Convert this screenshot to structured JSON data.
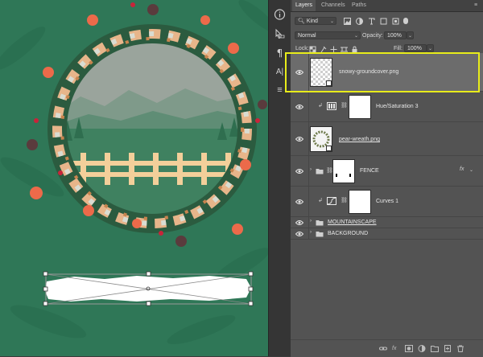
{
  "panel": {
    "tabs": [
      {
        "label": "Layers",
        "active": true
      },
      {
        "label": "Channels",
        "active": false
      },
      {
        "label": "Paths",
        "active": false
      }
    ],
    "filter": {
      "kind_label": "Kind"
    },
    "blend": {
      "mode": "Normal",
      "opacity_label": "Opacity:",
      "opacity_value": "100%"
    },
    "lock": {
      "label": "Lock:",
      "fill_label": "Fill:",
      "fill_value": "100%"
    },
    "layers": [
      {
        "name": "snowy-groundcover.png",
        "type": "smart-object",
        "selected": true,
        "visible": true
      },
      {
        "name": "Hue/Saturation 3",
        "type": "adjustment-hue-saturation",
        "clipped": true,
        "visible": true
      },
      {
        "name": "pear-wreath.png",
        "type": "smart-object",
        "visible": true
      },
      {
        "name": "FENCE",
        "type": "group",
        "collapsed": true,
        "has_mask": true,
        "fx": "fx",
        "visible": true
      },
      {
        "name": "Curves 1",
        "type": "adjustment-curves",
        "clipped": true,
        "visible": true
      },
      {
        "name": "MOUNTAINSCAPE",
        "type": "group",
        "collapsed": true,
        "visible": true
      },
      {
        "name": "BACKGROUND",
        "type": "group",
        "collapsed": true,
        "visible": true
      }
    ]
  },
  "tools": [
    "info-icon",
    "path-selection-icon",
    "paragraph-icon",
    "character-icon",
    "properties-icon"
  ],
  "tool_text": {
    "paragraph": "¶",
    "character": "A|",
    "properties": "≡"
  },
  "bottom_icons": {
    "fx": "fx"
  },
  "colors": {
    "canvas_green": "#2f7757",
    "panel_bg": "#535353",
    "selected_row": "#6c6c6c",
    "highlight": "#e8ec1a",
    "fence": "#f3cf9a",
    "sky": "#9aa49c"
  }
}
